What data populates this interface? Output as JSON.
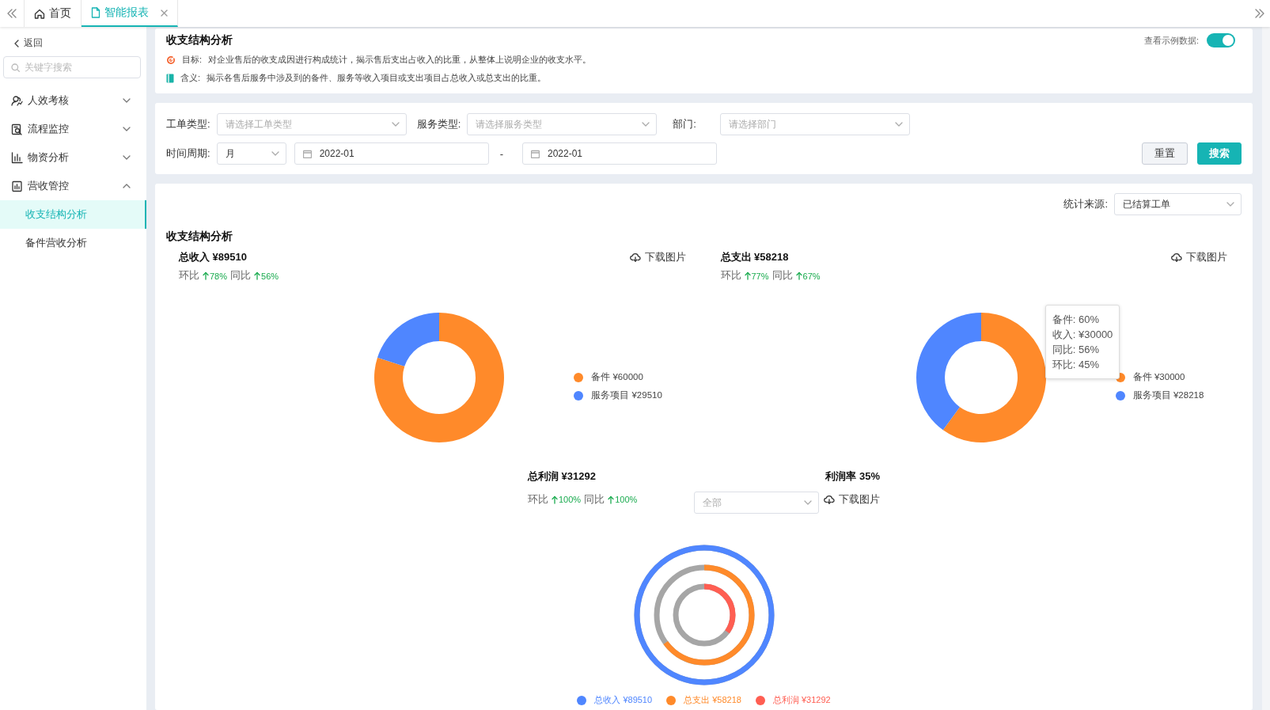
{
  "tabs": [
    {
      "label": "首页",
      "selected": false,
      "closable": false
    },
    {
      "label": "智能报表",
      "selected": true,
      "closable": true
    }
  ],
  "sidebar": {
    "back": "返回",
    "search_placeholder": "关键字搜索",
    "items": [
      {
        "label": "人效考核",
        "expanded": false
      },
      {
        "label": "流程监控",
        "expanded": false
      },
      {
        "label": "物资分析",
        "expanded": false
      },
      {
        "label": "营收管控",
        "expanded": true,
        "children": [
          {
            "label": "收支结构分析",
            "selected": true
          },
          {
            "label": "备件营收分析",
            "selected": false
          }
        ]
      }
    ]
  },
  "header": {
    "title": "收支结构分析",
    "toggle": {
      "label": "查看示例数据:",
      "on": true
    },
    "notes": [
      {
        "label": "目标:",
        "text": "对企业售后的收支成因进行构成统计，揭示售后支出占收入的比重，从整体上说明企业的收支水平。"
      },
      {
        "label": "含义:",
        "text": "揭示各售后服务中涉及到的备件、服务等收入项目或支出项目占总收入或总支出的比重。"
      }
    ]
  },
  "filters": {
    "fields": [
      {
        "label": "工单类型:",
        "placeholder": "请选择工单类型"
      },
      {
        "label": "服务类型:",
        "placeholder": "请选择服务类型"
      },
      {
        "label": "部门:",
        "placeholder": "请选择部门"
      }
    ],
    "period": {
      "label": "时间周期:",
      "unit": "月",
      "start": "2022-01",
      "separator": "-",
      "end": "2022-01"
    },
    "buttons": [
      {
        "label": "重置",
        "kind": "default"
      },
      {
        "label": "搜索",
        "kind": "primary"
      }
    ]
  },
  "analysis": {
    "source": {
      "label": "统计来源:",
      "value": "已结算工单"
    },
    "title": "收支结构分析",
    "panels": [
      {
        "title": "总收入 ¥89510",
        "mom_label": "环比",
        "mom": "78%",
        "yoy_label": "同比",
        "yoy": "56%",
        "download": "下载图片",
        "chart_data": {
          "type": "donut",
          "values": [
            80,
            20
          ]
        },
        "legend": [
          {
            "label": "备件 ¥60000",
            "color": "#ff8a2a"
          },
          {
            "label": "服务项目 ¥29510",
            "color": "#4f86ff"
          }
        ]
      },
      {
        "title": "总支出 ¥58218",
        "mom_label": "环比",
        "mom": "77%",
        "yoy_label": "同比",
        "yoy": "67%",
        "download": "下载图片",
        "chart_data": {
          "type": "donut",
          "values": [
            60,
            40
          ]
        },
        "legend": [
          {
            "label": "备件 ¥30000",
            "color": "#ff8a2a"
          },
          {
            "label": "服务项目 ¥28218",
            "color": "#4f86ff"
          }
        ],
        "tooltip": [
          "备件: 60%",
          "收入: ¥30000",
          "同比: 56%",
          "环比: 45%"
        ]
      }
    ],
    "profit": {
      "title": "总利润 ¥31292",
      "rate": "利润率 35%",
      "mom_label": "环比",
      "mom": "100%",
      "yoy_label": "同比",
      "yoy": "100%",
      "filter_placeholder": "全部",
      "download": "下载图片",
      "rings": [
        {
          "level": 1,
          "color": "#4f86ff"
        },
        {
          "level": 0.65,
          "color": "#ff8a2a"
        },
        {
          "level": 0.35,
          "color": "#ff5e52"
        }
      ],
      "legend": [
        {
          "label": "总收入 ¥89510",
          "color": "#4f86ff"
        },
        {
          "label": "总支出 ¥58218",
          "color": "#ff8a2a"
        },
        {
          "label": "总利润 ¥31292",
          "color": "#ff5e52"
        }
      ]
    }
  }
}
